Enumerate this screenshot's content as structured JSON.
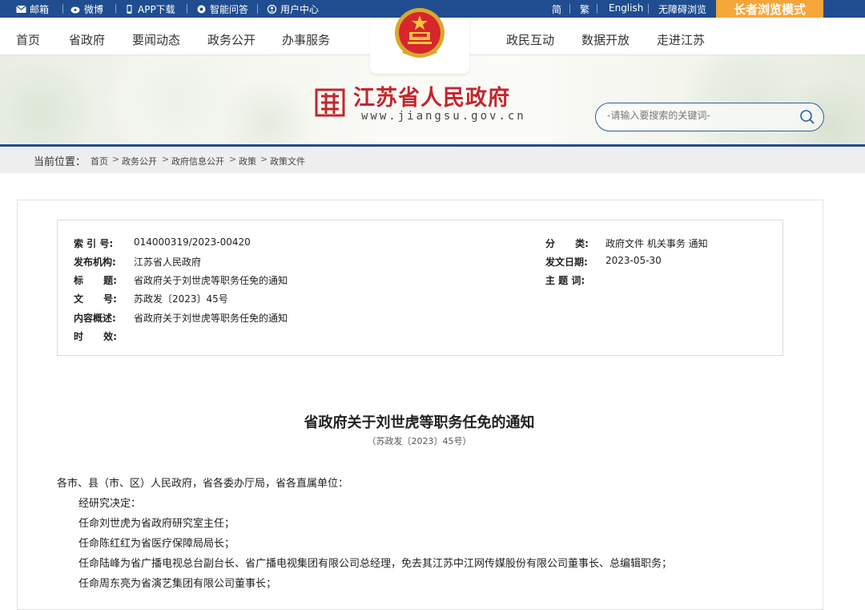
{
  "topbar": {
    "left": [
      "邮箱",
      "微博",
      "APP下载",
      "智能问答",
      "用户中心"
    ],
    "right": [
      "简",
      "繁",
      "English",
      "无障碍浏览"
    ],
    "elder_mode": "长者浏览模式"
  },
  "nav": {
    "left": [
      "首页",
      "省政府",
      "要闻动态",
      "政务公开",
      "办事服务"
    ],
    "right": [
      "政民互动",
      "数据开放",
      "走进江苏"
    ]
  },
  "site": {
    "title": "江苏省人民政府",
    "url": "www.jiangsu.gov.cn"
  },
  "search": {
    "placeholder": "-请输入要搜索的关键词-"
  },
  "breadcrumb": {
    "label": "当前位置：",
    "items": [
      "首页",
      "政务公开",
      "政府信息公开",
      "政策",
      "政策文件"
    ]
  },
  "meta": {
    "index_label": "索 引 号:",
    "index": "014000319/2023-00420",
    "category_label": "分      类:",
    "category": "政府文件 机关事务 通知",
    "publisher_label": "发布机构:",
    "publisher": "江苏省人民政府",
    "date_label": "发文日期:",
    "date": "2023-05-30",
    "title_label": "标      题:",
    "title": "省政府关于刘世虎等职务任免的通知",
    "subject_label": "主 题 词:",
    "subject": "",
    "docno_label": "文      号:",
    "docno": "苏政发〔2023〕45号",
    "summary_label": "内容概述:",
    "summary": "省政府关于刘世虎等职务任免的通知",
    "validity_label": "时      效:",
    "validity": ""
  },
  "doc": {
    "title": "省政府关于刘世虎等职务任免的通知",
    "number": "（苏政发〔2023〕45号）",
    "addressee": "各市、县（市、区）人民政府，省各委办厅局，省各直属单位：",
    "paragraphs": [
      "经研究决定：",
      "任命刘世虎为省政府研究室主任；",
      "任命陈红红为省医疗保障局局长；",
      "任命陆峰为省广播电视总台副台长、省广播电视集团有限公司总经理，免去其江苏中江网传媒股份有限公司董事长、总编辑职务；",
      "任命周东亮为省演艺集团有限公司董事长；"
    ]
  },
  "colors": {
    "primary": "#1f4d8f",
    "brand_red": "#c3262e",
    "elder": "#f7a63a"
  }
}
